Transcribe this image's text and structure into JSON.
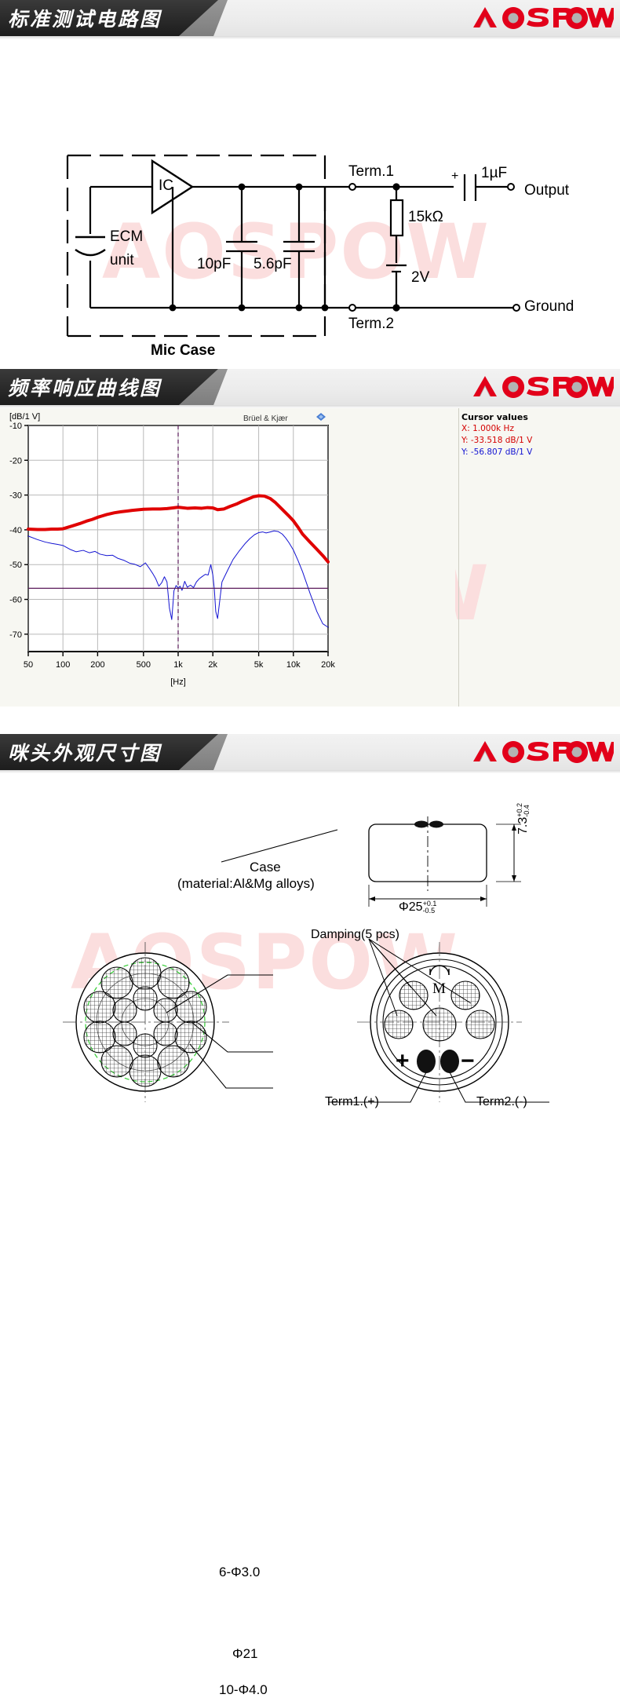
{
  "brand": {
    "logo_text": "AOSPOW",
    "logo_color": "#e2001a",
    "logo_accent": "#a8a8a8",
    "watermark_text": "AOSPOW",
    "watermark_color": "#fbdede"
  },
  "sections": [
    {
      "id": "circuit",
      "title": "标准测试电路图"
    },
    {
      "id": "frequency",
      "title": "频率响应曲线图"
    },
    {
      "id": "dimension",
      "title": "咪头外观尺寸图"
    }
  ],
  "circuit": {
    "ic_label": "IC",
    "ecm_label_line1": "ECM",
    "ecm_label_line2": "unit",
    "cap1": "10pF",
    "cap2": "5.6pF",
    "case_label": "Mic Case",
    "term1": "Term.1",
    "term2": "Term.2",
    "resistor": "15kΩ",
    "battery": "2V",
    "coupling_cap": "1µF",
    "polarity": "+",
    "output": "Output",
    "ground": "Ground"
  },
  "chart_data": {
    "type": "line",
    "title": "",
    "xlabel": "[Hz]",
    "ylabel": "[dB/1 V]",
    "watermark": "Brüel & Kjær",
    "xscale": "log",
    "xlim": [
      50,
      20000
    ],
    "ylim": [
      -75,
      -10
    ],
    "xticks": [
      50,
      100,
      200,
      500,
      1000,
      2000,
      5000,
      10000,
      20000
    ],
    "xtick_labels": [
      "50",
      "100",
      "200",
      "500",
      "1k",
      "2k",
      "5k",
      "10k",
      "20k"
    ],
    "yticks": [
      -10,
      -20,
      -30,
      -40,
      -50,
      -60,
      -70
    ],
    "ytick_labels": [
      "-10",
      "-20",
      "-30",
      "-40",
      "-50",
      "-60",
      "-70"
    ],
    "grid": true,
    "legend": "none",
    "cursor": {
      "title": "Cursor values",
      "x_line": "X: 1.000k Hz",
      "y_red_line": "Y: -33.518 dB/1 V",
      "y_blue_line": "Y: -56.807 dB/1 V",
      "x_hz": 1000,
      "y_red": -33.518,
      "y_blue": -56.807,
      "red_color": "#d40000",
      "blue_color": "#1414d2"
    },
    "series": [
      {
        "name": "response",
        "color": "#e00000",
        "width": 4,
        "x": [
          50,
          60,
          70,
          80,
          90,
          100,
          120,
          140,
          160,
          180,
          200,
          240,
          280,
          320,
          360,
          400,
          500,
          600,
          700,
          800,
          900,
          1000,
          1200,
          1400,
          1600,
          1800,
          2000,
          2200,
          2500,
          2800,
          3200,
          3600,
          4000,
          4500,
          5000,
          5600,
          6300,
          7000,
          8000,
          9000,
          10000,
          11000,
          12000,
          14000,
          16000,
          18000,
          20000
        ],
        "y": [
          -39.8,
          -39.9,
          -39.9,
          -39.8,
          -39.8,
          -39.7,
          -38.9,
          -38.2,
          -37.5,
          -37.0,
          -36.4,
          -35.6,
          -35.1,
          -34.8,
          -34.6,
          -34.4,
          -34.1,
          -34.0,
          -34.0,
          -33.9,
          -33.7,
          -33.5,
          -33.8,
          -33.7,
          -33.8,
          -33.6,
          -33.7,
          -34.2,
          -34.0,
          -33.3,
          -32.6,
          -31.8,
          -31.2,
          -30.5,
          -30.2,
          -30.3,
          -31.0,
          -32.2,
          -34.1,
          -35.8,
          -37.4,
          -39.3,
          -41.2,
          -43.6,
          -45.6,
          -47.4,
          -49.2
        ]
      },
      {
        "name": "distortion",
        "color": "#1414d2",
        "width": 1,
        "x": [
          50,
          60,
          70,
          80,
          90,
          100,
          115,
          130,
          150,
          170,
          190,
          210,
          240,
          270,
          300,
          340,
          380,
          420,
          470,
          520,
          560,
          600,
          640,
          680,
          720,
          760,
          800,
          840,
          880,
          920,
          960,
          1000,
          1040,
          1080,
          1140,
          1200,
          1280,
          1360,
          1440,
          1520,
          1620,
          1720,
          1820,
          1920,
          2000,
          2060,
          2120,
          2200,
          2400,
          2700,
          3000,
          3400,
          3800,
          4200,
          4600,
          5000,
          5400,
          5800,
          6300,
          6800,
          7400,
          8000,
          8600,
          9200,
          10000,
          11000,
          12000,
          13000,
          14000,
          16000,
          18000,
          20000
        ],
        "y": [
          -41.8,
          -42.8,
          -43.5,
          -43.9,
          -44.2,
          -44.5,
          -45.6,
          -46.3,
          -45.9,
          -46.6,
          -46.2,
          -47.0,
          -47.4,
          -47.3,
          -48.2,
          -48.8,
          -49.6,
          -49.9,
          -50.6,
          -49.5,
          -51.0,
          -52.5,
          -54.1,
          -56.2,
          -55.2,
          -53.5,
          -55.0,
          -62.5,
          -65.8,
          -57.5,
          -56.0,
          -56.8,
          -56.2,
          -57.4,
          -54.8,
          -56.5,
          -55.9,
          -56.6,
          -55.0,
          -54.1,
          -53.4,
          -52.8,
          -53.0,
          -50.0,
          -53.0,
          -57.0,
          -63.5,
          -65.5,
          -55.0,
          -51.5,
          -48.5,
          -46.0,
          -44.0,
          -42.5,
          -41.4,
          -40.8,
          -40.6,
          -40.9,
          -40.6,
          -40.3,
          -40.5,
          -41.2,
          -42.4,
          -43.8,
          -45.8,
          -48.9,
          -52.0,
          -55.3,
          -58.4,
          -63.5,
          -67.0,
          -68.0
        ]
      }
    ]
  },
  "dimension": {
    "case_label_line1": "Case",
    "case_label_line2": "(material:Al&Mg alloys)",
    "height_dim": "7.3",
    "height_tol_up": "+0.2",
    "height_tol_dn": "-0.4",
    "diameter_dim": "Φ25",
    "diameter_tol_up": "+0.1",
    "diameter_tol_dn": "-0.5",
    "hole_small": "6-Φ3.0",
    "hole_large": "10-Φ4.0",
    "inner_circle": "Φ21",
    "damping": "Damping(5 pcs)",
    "mark_m": "M",
    "plus": "+",
    "minus": "−",
    "term1": "Term1.(+)",
    "term2": "Term2.(-)"
  }
}
